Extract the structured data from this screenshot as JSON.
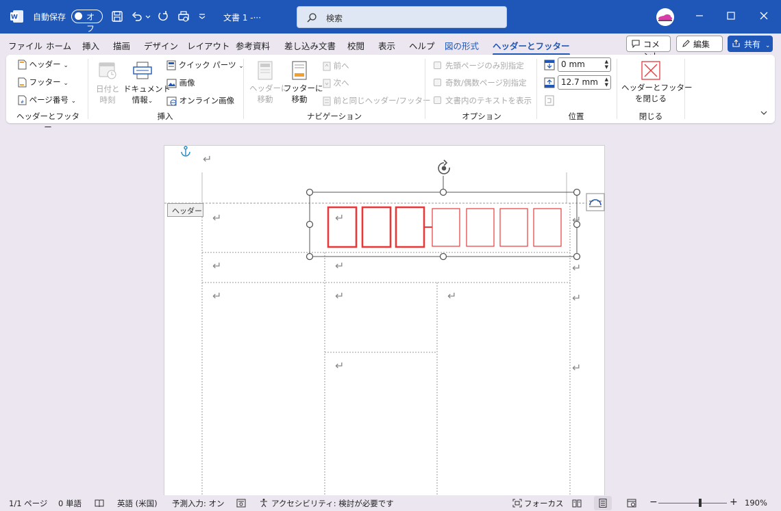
{
  "titlebar": {
    "autosave_label": "自動保存",
    "autosave_state": "オフ",
    "doc_title": "文書 1  -···",
    "search_placeholder": "検索"
  },
  "menu": {
    "tabs": [
      "ファイル",
      "ホーム",
      "挿入",
      "描画",
      "デザイン",
      "レイアウト",
      "参考資料",
      "差し込み文書",
      "校閲",
      "表示",
      "ヘルプ",
      "図の形式",
      "ヘッダーとフッター"
    ],
    "comment_label": "コメント",
    "edit_label": "編集",
    "share_label": "共有"
  },
  "ribbon": {
    "header_btn": "ヘッダー",
    "footer_btn": "フッター",
    "pagenum_btn": "ページ番号",
    "group_hf": "ヘッダーとフッター",
    "datetime_l1": "日付と",
    "datetime_l2": "時刻",
    "docinfo_l1": "ドキュメント",
    "docinfo_l2": "情報",
    "quickparts": "クイック パーツ",
    "picture": "画像",
    "online_picture": "オンライン画像",
    "group_insert": "挿入",
    "goto_header_l1": "ヘッダーに",
    "goto_header_l2": "移動",
    "goto_footer_l1": "フッターに",
    "goto_footer_l2": "移動",
    "prev": "前へ",
    "next": "次へ",
    "link_prev": "前と同じヘッダー/フッター",
    "group_nav": "ナビゲーション",
    "opt_first": "先頭ページのみ別指定",
    "opt_oddeven": "奇数/偶数ページ別指定",
    "opt_showtext": "文書内のテキストを表示",
    "group_options": "オプション",
    "header_pos": "0 mm",
    "footer_pos": "12.7 mm",
    "group_position": "位置",
    "close_l1": "ヘッダーとフッター",
    "close_l2": "を閉じる",
    "group_close": "閉じる"
  },
  "document": {
    "header_tag": "ヘッダー"
  },
  "status": {
    "page": "1/1 ページ",
    "words": "0 単語",
    "language": "英語 (米国)",
    "predictive": "予測入力: オン",
    "accessibility": "アクセシビリティ: 検討が必要です",
    "focus": "フォーカス",
    "zoom": "190%"
  },
  "colors": {
    "accent": "#1e57b8",
    "stamp_red": "#e8393a"
  }
}
